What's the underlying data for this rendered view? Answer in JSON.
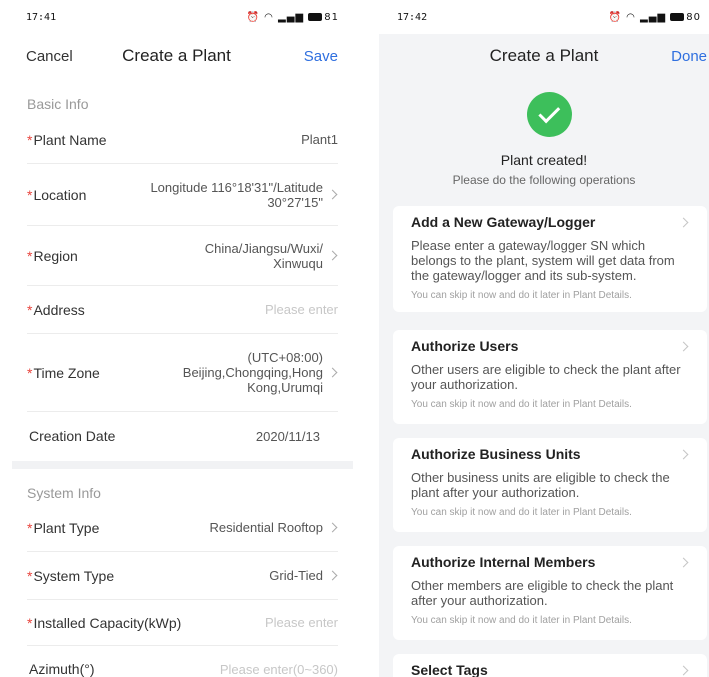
{
  "left": {
    "status": {
      "time": "17:41",
      "battery": "81"
    },
    "nav": {
      "cancel": "Cancel",
      "title": "Create a Plant",
      "save": "Save"
    },
    "basic_info": {
      "heading": "Basic Info",
      "plant_name": {
        "label": "Plant Name",
        "value": "Plant1"
      },
      "location": {
        "label": "Location",
        "value": "Longitude 116°18'31\"/Latitude\n30°27'15\""
      },
      "region": {
        "label": "Region",
        "value": "China/Jiangsu/Wuxi/\nXinwuqu"
      },
      "address": {
        "label": "Address",
        "placeholder": "Please enter"
      },
      "time_zone": {
        "label": "Time Zone",
        "value": "(UTC+08:00)\nBeijing,Chongqing,Hong\nKong,Urumqi"
      },
      "creation_date": {
        "label": "Creation Date",
        "value": "2020/11/13"
      }
    },
    "system_info": {
      "heading": "System Info",
      "plant_type": {
        "label": "Plant Type",
        "value": "Residential Rooftop"
      },
      "system_type": {
        "label": "System Type",
        "value": "Grid-Tied"
      },
      "installed_capacity": {
        "label": "Installed Capacity(kWp)",
        "placeholder": "Please enter"
      },
      "azimuth": {
        "label": "Azimuth(°)",
        "placeholder": "Please enter(0~360)"
      }
    },
    "required_mark": "*"
  },
  "right": {
    "status": {
      "time": "17:42",
      "battery": "80"
    },
    "nav": {
      "title": "Create a Plant",
      "done": "Done"
    },
    "success": {
      "title": "Plant created!",
      "subtitle": "Please do the following operations"
    },
    "cards": [
      {
        "title": "Add a New Gateway/Logger",
        "body": "Please enter a gateway/logger SN which belongs to the plant, system will get data from the gateway/logger and its sub-system.",
        "note": "You can skip it now and do it later in Plant Details."
      },
      {
        "title": "Authorize Users",
        "body": "Other users are eligible to check the plant after your authorization.",
        "note": "You can skip it now and do it later in Plant Details."
      },
      {
        "title": "Authorize Business Units",
        "body": "Other business units are eligible to check the plant after your authorization.",
        "note": "You can skip it now and do it later in Plant Details."
      },
      {
        "title": "Authorize Internal Members",
        "body": "Other members are eligible to check the plant after your authorization.",
        "note": "You can skip it now and do it later in Plant Details."
      },
      {
        "title": "Select Tags"
      }
    ]
  },
  "colors": {
    "accent": "#2f6fdf",
    "required": "#e8433c",
    "success": "#3dbf5b"
  },
  "icons": [
    "chevron-right-icon",
    "check-circle-icon",
    "battery-icon",
    "wifi-icon",
    "signal-icon",
    "alarm-icon"
  ]
}
